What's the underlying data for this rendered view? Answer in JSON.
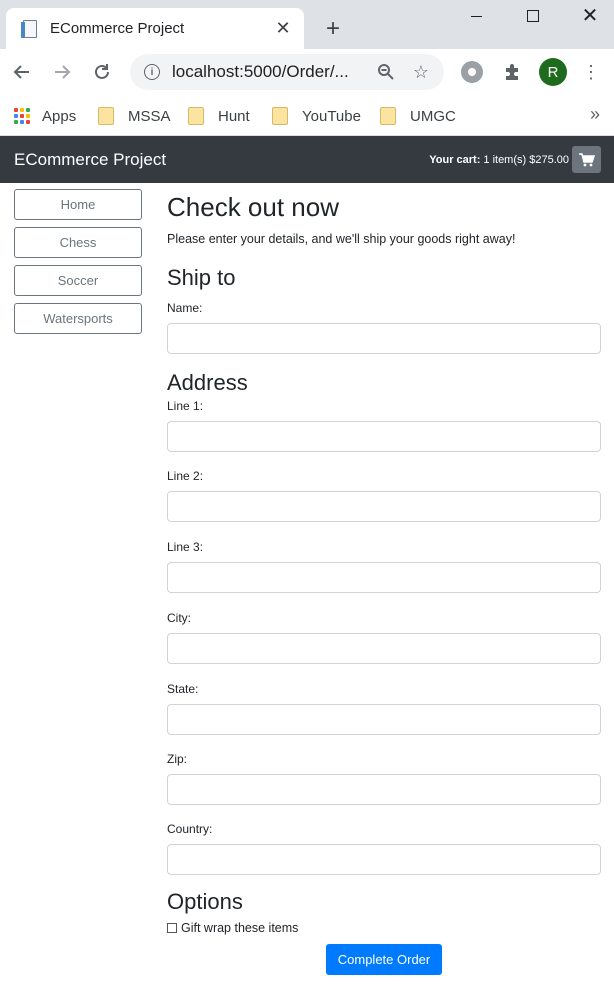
{
  "browser": {
    "tab_title": "ECommerce Project",
    "url": "localhost:5000/Order/...",
    "bookmarks": [
      {
        "label": "Apps"
      },
      {
        "label": "MSSA"
      },
      {
        "label": "Hunt"
      },
      {
        "label": "YouTube"
      },
      {
        "label": "UMGC"
      }
    ],
    "profile_initial": "R",
    "bookmarks_more": "»"
  },
  "app": {
    "brand": "ECommerce Project",
    "cart_label": "Your cart:",
    "cart_summary": "1 item(s) $275.00"
  },
  "sidebar": {
    "items": [
      {
        "label": "Home"
      },
      {
        "label": "Chess"
      },
      {
        "label": "Soccer"
      },
      {
        "label": "Watersports"
      }
    ]
  },
  "checkout": {
    "title": "Check out now",
    "lead": "Please enter your details, and we'll ship your goods right away!",
    "ship_to_heading": "Ship to",
    "name_label": "Name:",
    "address_heading": "Address",
    "line1_label": "Line 1:",
    "line2_label": "Line 2:",
    "line3_label": "Line 3:",
    "city_label": "City:",
    "state_label": "State:",
    "zip_label": "Zip:",
    "country_label": "Country:",
    "options_heading": "Options",
    "giftwrap_label": "Gift wrap these items",
    "giftwrap_checked": false,
    "submit_label": "Complete Order"
  },
  "colors": {
    "navbar": "#343a40",
    "primary": "#007bff",
    "secondary": "#6c757d"
  }
}
